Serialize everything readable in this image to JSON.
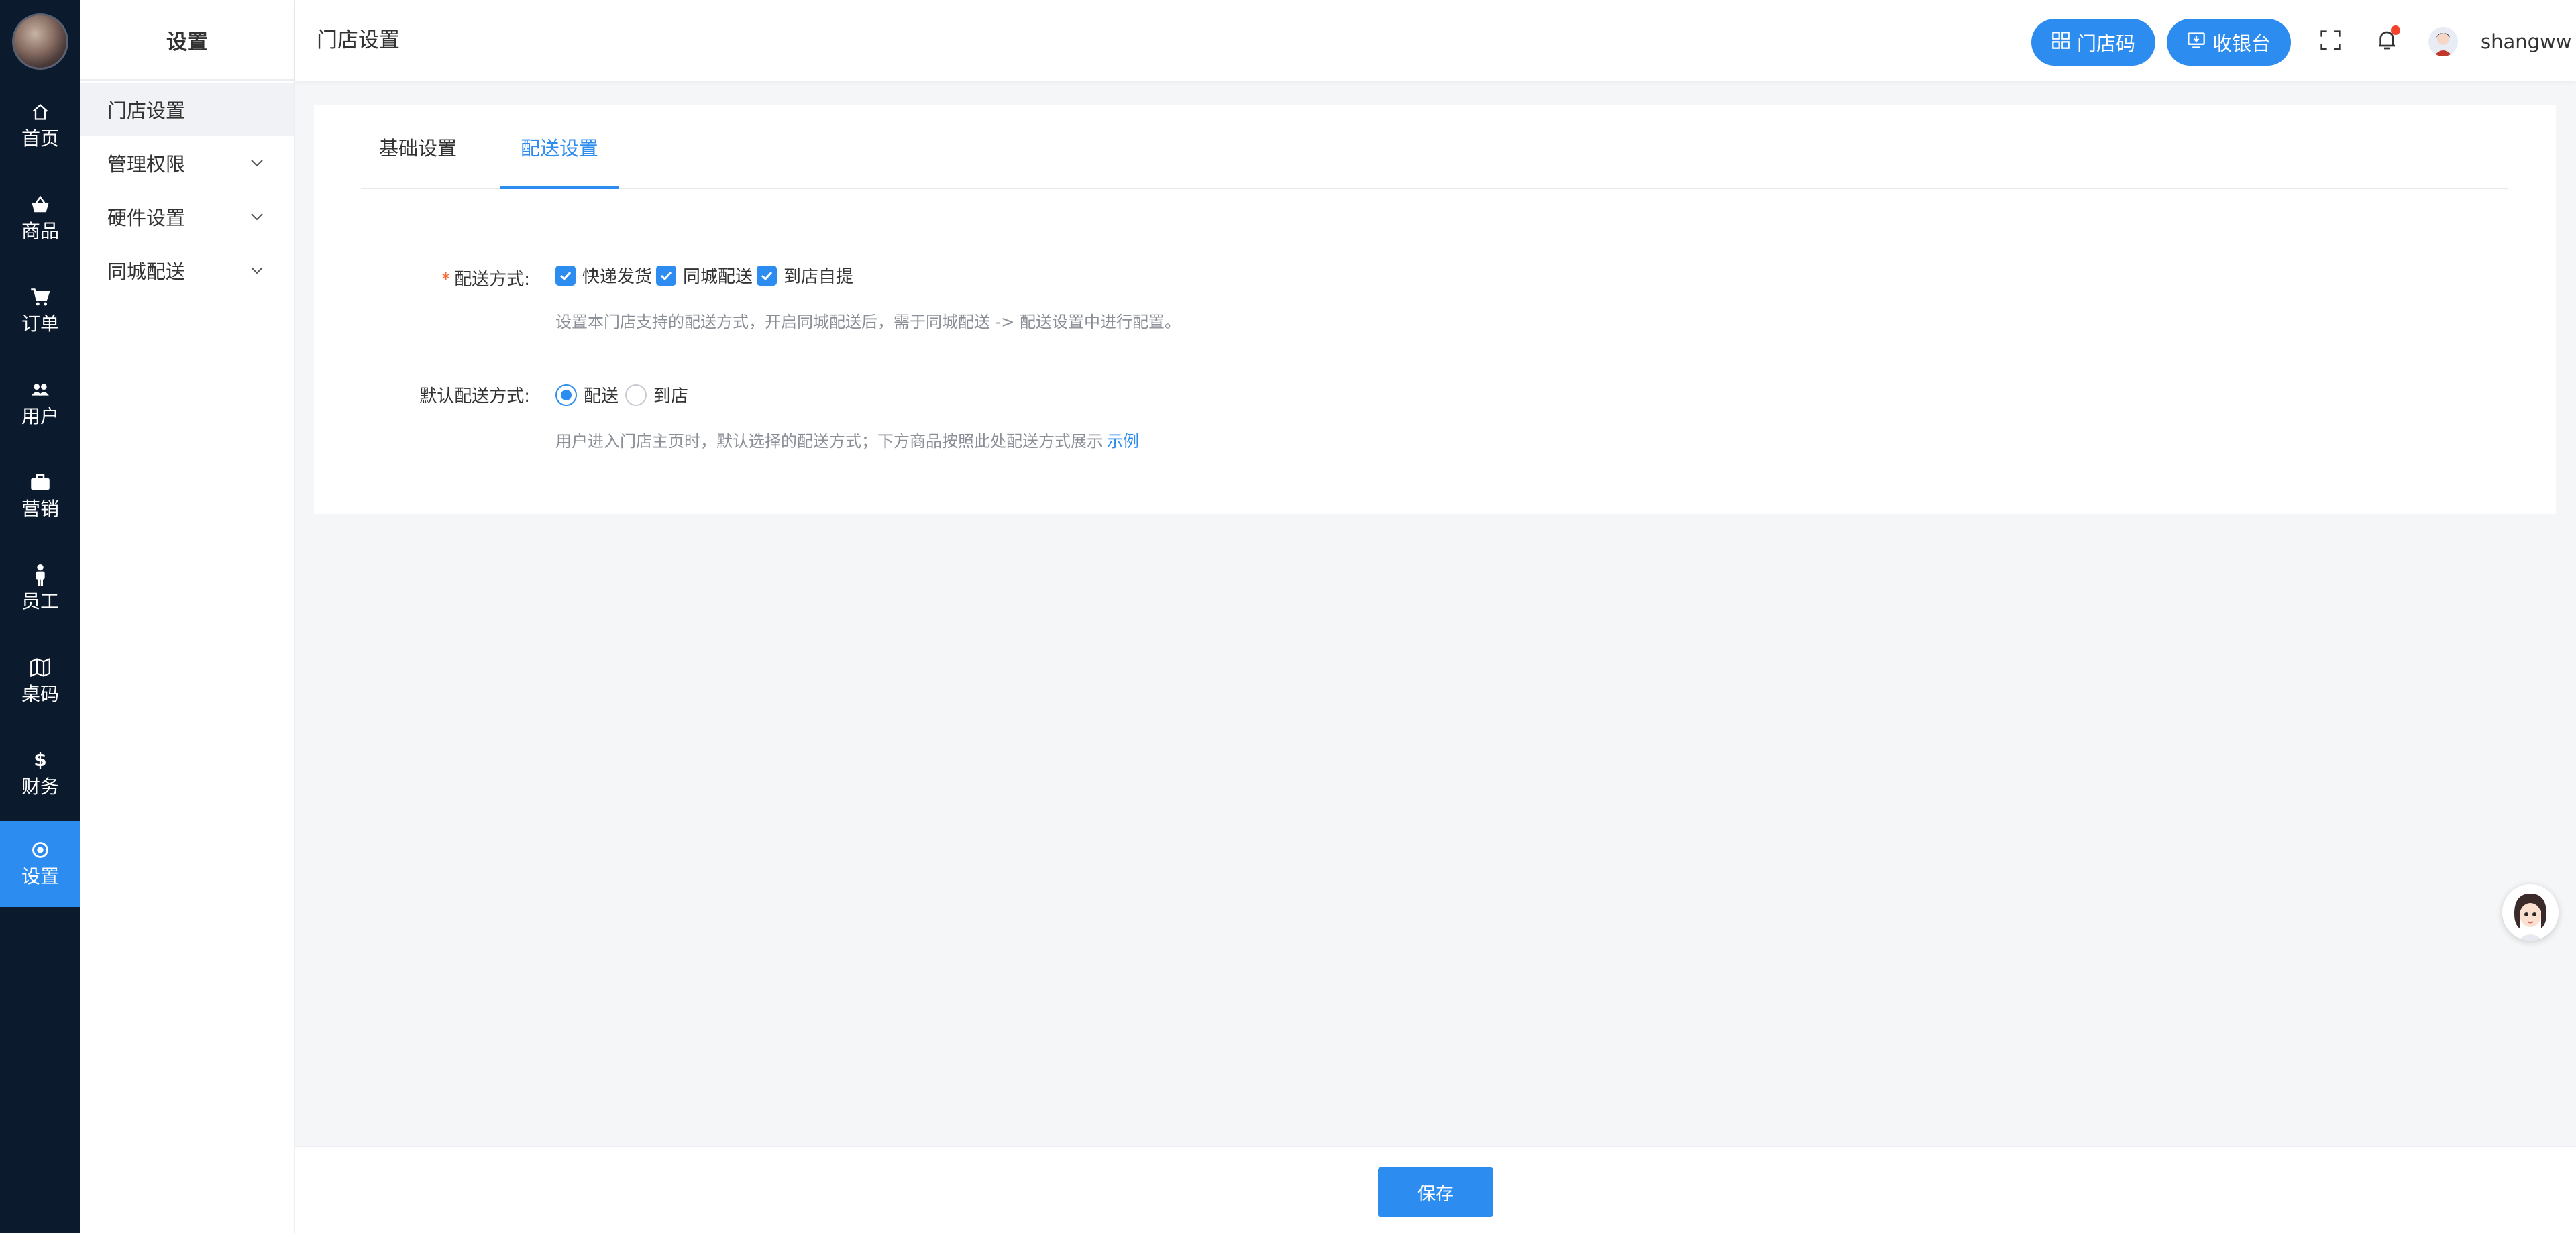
{
  "rail": {
    "items": [
      {
        "label": "首页",
        "icon": "home-icon"
      },
      {
        "label": "商品",
        "icon": "basket-icon"
      },
      {
        "label": "订单",
        "icon": "cart-icon"
      },
      {
        "label": "用户",
        "icon": "users-icon"
      },
      {
        "label": "营销",
        "icon": "briefcase-icon"
      },
      {
        "label": "员工",
        "icon": "person-icon"
      },
      {
        "label": "桌码",
        "icon": "map-icon"
      },
      {
        "label": "财务",
        "icon": "dollar-icon"
      },
      {
        "label": "设置",
        "icon": "settings-icon"
      }
    ],
    "active_index": 8
  },
  "sidebar": {
    "title": "设置",
    "items": [
      {
        "label": "门店设置"
      },
      {
        "label": "管理权限"
      },
      {
        "label": "硬件设置"
      },
      {
        "label": "同城配送"
      }
    ]
  },
  "header": {
    "page_title": "门店设置",
    "store_code_label": "门店码",
    "cashier_label": "收银台",
    "username": "shangww"
  },
  "tabs": [
    {
      "label": "基础设置"
    },
    {
      "label": "配送设置"
    }
  ],
  "form": {
    "delivery_method": {
      "label": "配送方式:",
      "options": [
        "快递发货",
        "同城配送",
        "到店自提"
      ],
      "help": "设置本门店支持的配送方式，开启同城配送后，需于同城配送 -> 配送设置中进行配置。"
    },
    "default_method": {
      "label": "默认配送方式:",
      "options": [
        "配送",
        "到店"
      ],
      "help": "用户进入门店主页时，默认选择的配送方式；下方商品按照此处配送方式展示",
      "example_link": "示例"
    }
  },
  "footer": {
    "save_label": "保存"
  },
  "colors": {
    "primary": "#2d8cf0",
    "rail_bg": "#0b1a2c",
    "required": "#f5642d",
    "notification": "#f5422d"
  }
}
